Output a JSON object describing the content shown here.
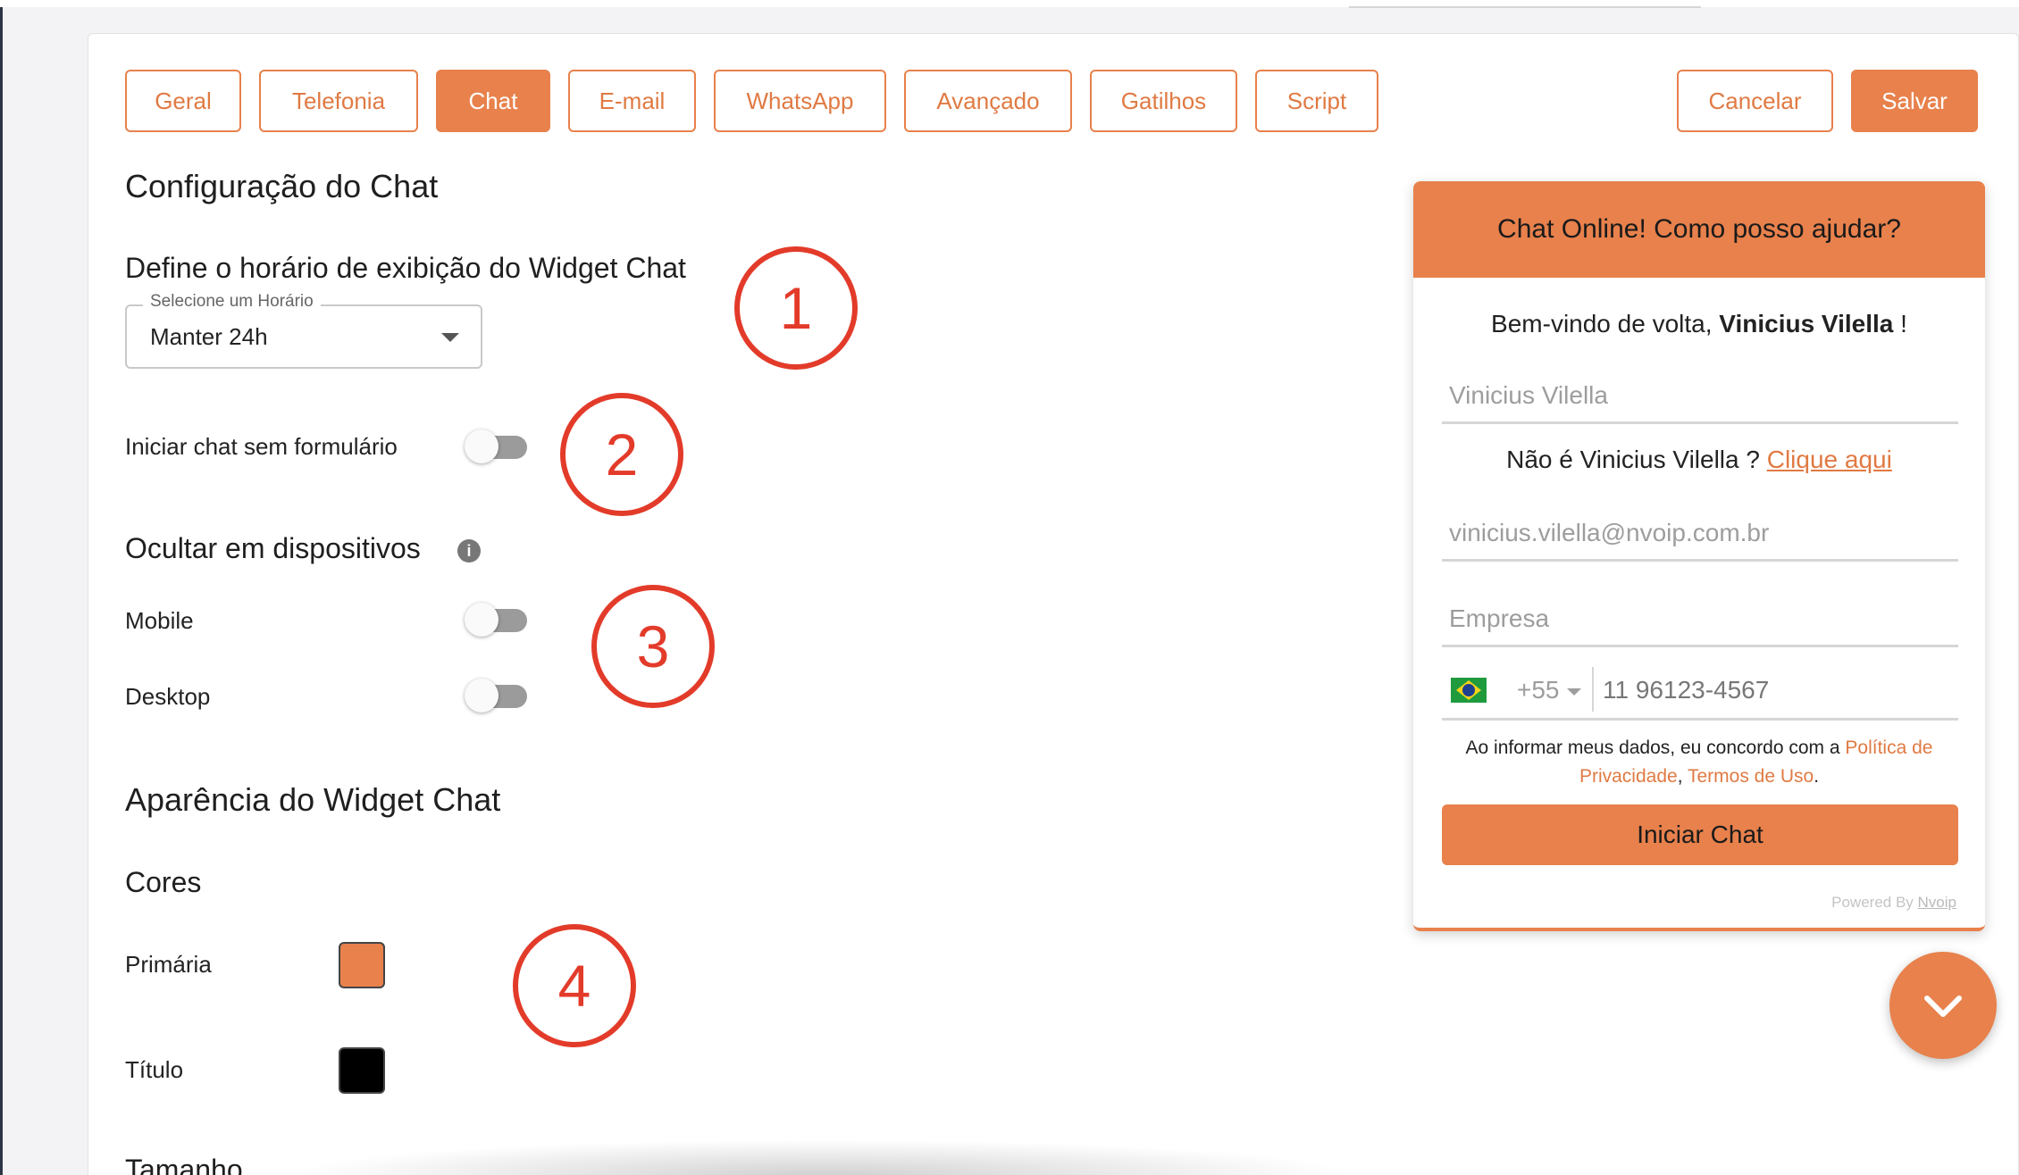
{
  "tabs": [
    {
      "label": "Geral",
      "active": false
    },
    {
      "label": "Telefonia",
      "active": false
    },
    {
      "label": "Chat",
      "active": true
    },
    {
      "label": "E-mail",
      "active": false
    },
    {
      "label": "WhatsApp",
      "active": false
    },
    {
      "label": "Avançado",
      "active": false
    },
    {
      "label": "Gatilhos",
      "active": false
    },
    {
      "label": "Script",
      "active": false
    }
  ],
  "actions": {
    "cancel_label": "Cancelar",
    "save_label": "Salvar"
  },
  "settings": {
    "title": "Configuração do Chat",
    "schedule_heading": "Define o horário de exibição do Widget Chat",
    "schedule_select": {
      "label": "Selecione um Horário",
      "value": "Manter 24h"
    },
    "start_without_form": {
      "label": "Iniciar chat sem formulário",
      "on": false
    },
    "hide_devices": {
      "heading": "Ocultar em dispositivos",
      "info_icon": "info-icon",
      "mobile": {
        "label": "Mobile",
        "on": false
      },
      "desktop": {
        "label": "Desktop",
        "on": false
      }
    },
    "appearance": {
      "heading": "Aparência do Widget Chat",
      "colors_heading": "Cores",
      "primary": {
        "label": "Primária",
        "color": "#e8814c"
      },
      "title_color": {
        "label": "Título",
        "color": "#000000"
      },
      "size_heading": "Tamanho"
    }
  },
  "annotations": [
    "1",
    "2",
    "3",
    "4"
  ],
  "widget": {
    "header": "Chat Online! Como posso ajudar?",
    "welcome_prefix": "Bem-vindo de volta, ",
    "welcome_name": "Vinicius Vilella",
    "welcome_suffix": " !",
    "name_value": "Vinicius Vilella",
    "not_you_prefix": "Não é Vinicius Vilella ? ",
    "not_you_link": "Clique aqui",
    "email_value": "vinicius.vilella@nvoip.com.br",
    "company_placeholder": "Empresa",
    "phone_code": "+55",
    "phone_value": "11 96123-4567",
    "consent_prefix": "Ao informar meus dados, eu concordo com a ",
    "privacy_line1": "Política de",
    "privacy_line2": "Privacidade",
    "consent_sep": ", ",
    "terms": "Termos de Uso",
    "consent_end": ".",
    "start_button": "Iniciar Chat",
    "powered_prefix": "Powered By ",
    "powered_brand": "Nvoip"
  },
  "fab_icon": "chevron-down-icon",
  "colors": {
    "accent": "#e8814c",
    "annotation": "#e33b2a"
  }
}
